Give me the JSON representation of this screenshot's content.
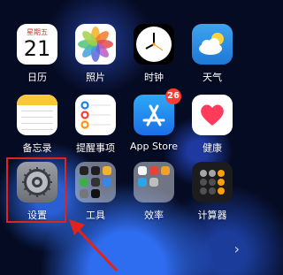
{
  "apps": {
    "calendar": {
      "label": "日历",
      "weekday": "星期五",
      "day": "21"
    },
    "photos": {
      "label": "照片"
    },
    "clock": {
      "label": "时钟"
    },
    "weather": {
      "label": "天气"
    },
    "notes": {
      "label": "备忘录"
    },
    "reminders": {
      "label": "提醒事项"
    },
    "appstore": {
      "label": "App Store",
      "badge": "26"
    },
    "health": {
      "label": "健康"
    },
    "settings": {
      "label": "设置"
    },
    "tools": {
      "label": "工具"
    },
    "efficiency": {
      "label": "效率"
    },
    "calculator": {
      "label": "计算器"
    }
  },
  "colors": {
    "highlight": "#e0231b",
    "badge": "#ff3b30"
  },
  "icons": {
    "next-page": "chevron-right-icon"
  }
}
